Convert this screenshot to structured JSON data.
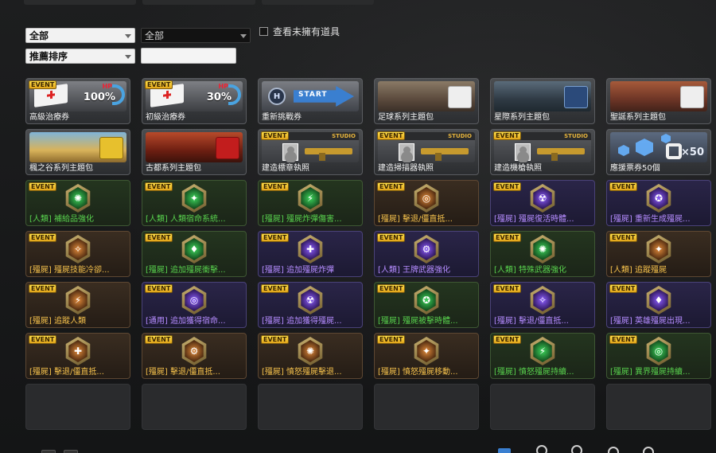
{
  "filters": {
    "category_value": "全部",
    "subcategory_value": "全部",
    "sort_value": "推薦排序",
    "search_value": "",
    "owned_toggle_label": "查看未擁有道具",
    "owned_checked": false
  },
  "colors": {
    "green_label": "#58d14d",
    "orange_label": "#f5c14c",
    "purple_label": "#b58cff",
    "event_badge": "#f2c12e"
  },
  "event_badge_text": "EVENT",
  "items": [
    {
      "label": "高級治療券",
      "tint": "normal",
      "label_color": "white",
      "event": true,
      "art": "hp-ticket",
      "hp_text": "HP",
      "hp_value": "100%"
    },
    {
      "label": "初級治療券",
      "tint": "normal",
      "label_color": "white",
      "event": true,
      "art": "hp-ticket",
      "hp_text": "HP",
      "hp_value": "30%"
    },
    {
      "label": "重新挑戰券",
      "tint": "normal",
      "label_color": "white",
      "event": false,
      "art": "start-ticket",
      "start_text": "START"
    },
    {
      "label": "足球系列主題包",
      "tint": "normal",
      "label_color": "white",
      "event": false,
      "art": "package-soccer"
    },
    {
      "label": "星際系列主題包",
      "tint": "normal",
      "label_color": "white",
      "event": false,
      "art": "package-space"
    },
    {
      "label": "聖誕系列主題包",
      "tint": "normal",
      "label_color": "white",
      "event": false,
      "art": "package-xmas"
    },
    {
      "label": "楓之谷系列主題包",
      "tint": "normal",
      "label_color": "white",
      "event": false,
      "art": "package-valley"
    },
    {
      "label": "古都系列主題包",
      "tint": "normal",
      "label_color": "white",
      "event": false,
      "art": "package-old"
    },
    {
      "label": "建造標章執照",
      "tint": "normal",
      "label_color": "white",
      "event": true,
      "art": "license",
      "studio_text": "STUDIO"
    },
    {
      "label": "建造掃描器執照",
      "tint": "normal",
      "label_color": "white",
      "event": true,
      "art": "license",
      "studio_text": "STUDIO"
    },
    {
      "label": "建造機槍執照",
      "tint": "normal",
      "label_color": "white",
      "event": true,
      "art": "license",
      "studio_text": "STUDIO"
    },
    {
      "label": "應援票券50個",
      "tint": "normal",
      "label_color": "white",
      "event": false,
      "art": "ticket",
      "ticket_count": "×50"
    },
    {
      "label": "[人類] 補給品強化",
      "tint": "green",
      "label_color": "green",
      "event": true,
      "art": "hex-green"
    },
    {
      "label": "[人類] 人類宿命系統...",
      "tint": "green",
      "label_color": "green",
      "event": true,
      "art": "hex-green"
    },
    {
      "label": "[殭屍] 殭屍炸彈傷害...",
      "tint": "green",
      "label_color": "green",
      "event": true,
      "art": "hex-green"
    },
    {
      "label": "[殭屍] 擊退/僵直抵...",
      "tint": "orange",
      "label_color": "orange",
      "event": true,
      "art": "hex-orange"
    },
    {
      "label": "[殭屍] 殭屍復活時體...",
      "tint": "purple",
      "label_color": "purple",
      "event": true,
      "art": "hex-purple"
    },
    {
      "label": "[殭屍] 重新生成殭屍...",
      "tint": "purple",
      "label_color": "purple",
      "event": true,
      "art": "hex-purple"
    },
    {
      "label": "[殭屍] 殭屍技能冷卻...",
      "tint": "orange",
      "label_color": "orange",
      "event": true,
      "art": "hex-orange"
    },
    {
      "label": "[殭屍] 追加殭屍衝擊...",
      "tint": "green",
      "label_color": "green",
      "event": true,
      "art": "hex-green"
    },
    {
      "label": "[殭屍] 追加殭屍炸彈",
      "tint": "purple",
      "label_color": "purple",
      "event": true,
      "art": "hex-purple"
    },
    {
      "label": "[人類] 王牌武器強化",
      "tint": "purple",
      "label_color": "purple",
      "event": true,
      "art": "hex-purple"
    },
    {
      "label": "[人類] 特殊武器強化",
      "tint": "green",
      "label_color": "green",
      "event": true,
      "art": "hex-green"
    },
    {
      "label": "[人類] 追蹤殭屍",
      "tint": "orange",
      "label_color": "orange",
      "event": true,
      "art": "hex-orange"
    },
    {
      "label": "[殭屍] 追蹤人類",
      "tint": "orange",
      "label_color": "orange",
      "event": true,
      "art": "hex-orange"
    },
    {
      "label": "[通用] 追加獲得宿命...",
      "tint": "purple",
      "label_color": "purple",
      "event": true,
      "art": "hex-purple"
    },
    {
      "label": "[殭屍] 追加獲得殭屍...",
      "tint": "purple",
      "label_color": "purple",
      "event": true,
      "art": "hex-purple"
    },
    {
      "label": "[殭屍] 殭屍被擊時體...",
      "tint": "green",
      "label_color": "green",
      "event": true,
      "art": "hex-green"
    },
    {
      "label": "[殭屍] 擊退/僵直抵...",
      "tint": "purple",
      "label_color": "purple",
      "event": true,
      "art": "hex-purple"
    },
    {
      "label": "[殭屍] 英雄殭屍出現...",
      "tint": "purple",
      "label_color": "purple",
      "event": true,
      "art": "hex-purple"
    },
    {
      "label": "[殭屍] 擊退/僵直抵...",
      "tint": "orange",
      "label_color": "orange",
      "event": true,
      "art": "hex-orange"
    },
    {
      "label": "[殭屍] 擊退/僵直抵...",
      "tint": "orange",
      "label_color": "orange",
      "event": true,
      "art": "hex-orange"
    },
    {
      "label": "[殭屍] 憤怒殭屍擊退...",
      "tint": "orange",
      "label_color": "orange",
      "event": true,
      "art": "hex-orange"
    },
    {
      "label": "[殭屍] 憤怒殭屍移動...",
      "tint": "orange",
      "label_color": "orange",
      "event": true,
      "art": "hex-orange"
    },
    {
      "label": "[殭屍] 憤怒殭屍持續...",
      "tint": "green",
      "label_color": "green",
      "event": true,
      "art": "hex-green"
    },
    {
      "label": "[殭屍] 異界殭屍持續...",
      "tint": "green",
      "label_color": "green",
      "event": true,
      "art": "hex-green"
    },
    {
      "label": "",
      "tint": "empty",
      "label_color": "white",
      "event": false,
      "art": "none"
    },
    {
      "label": "",
      "tint": "empty",
      "label_color": "white",
      "event": false,
      "art": "none"
    },
    {
      "label": "",
      "tint": "empty",
      "label_color": "white",
      "event": false,
      "art": "none"
    },
    {
      "label": "",
      "tint": "empty",
      "label_color": "white",
      "event": false,
      "art": "none"
    },
    {
      "label": "",
      "tint": "empty",
      "label_color": "white",
      "event": false,
      "art": "none"
    },
    {
      "label": "",
      "tint": "empty",
      "label_color": "white",
      "event": false,
      "art": "none"
    }
  ]
}
